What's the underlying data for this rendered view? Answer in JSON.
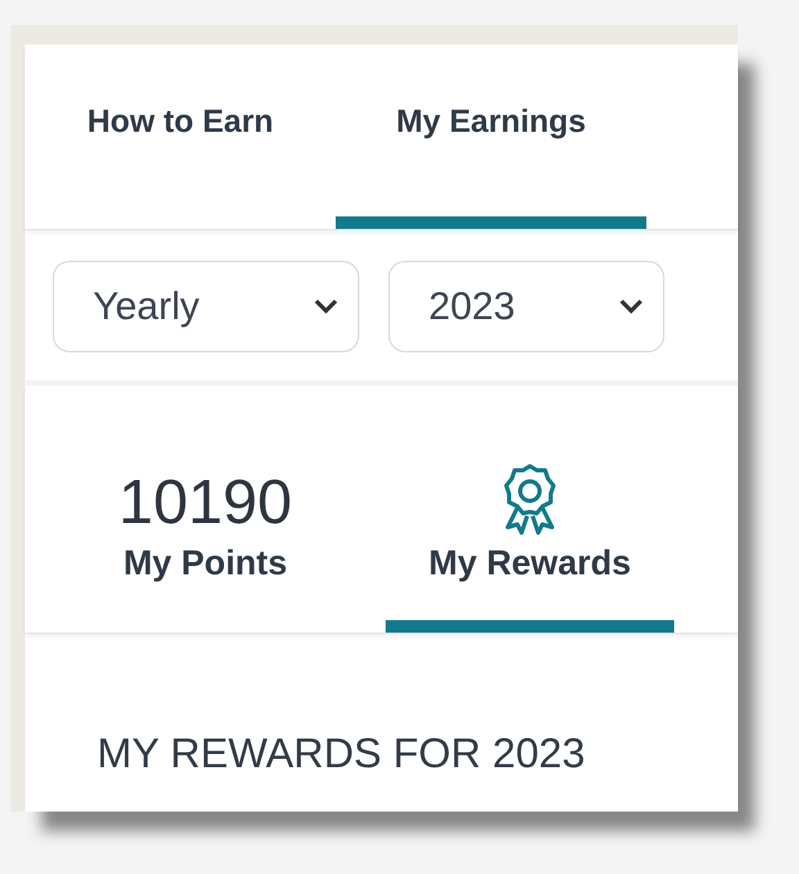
{
  "tabs": [
    {
      "label": "How to Earn",
      "selected": false
    },
    {
      "label": "My Earnings",
      "selected": true
    }
  ],
  "filters": [
    {
      "value": "Yearly"
    },
    {
      "value": "2023"
    }
  ],
  "summary": [
    {
      "kind": "number",
      "value": "10190",
      "label": "My Points",
      "selected": false
    },
    {
      "kind": "icon",
      "label": "My Rewards",
      "selected": true
    }
  ],
  "section_heading": "MY REWARDS FOR 2023"
}
